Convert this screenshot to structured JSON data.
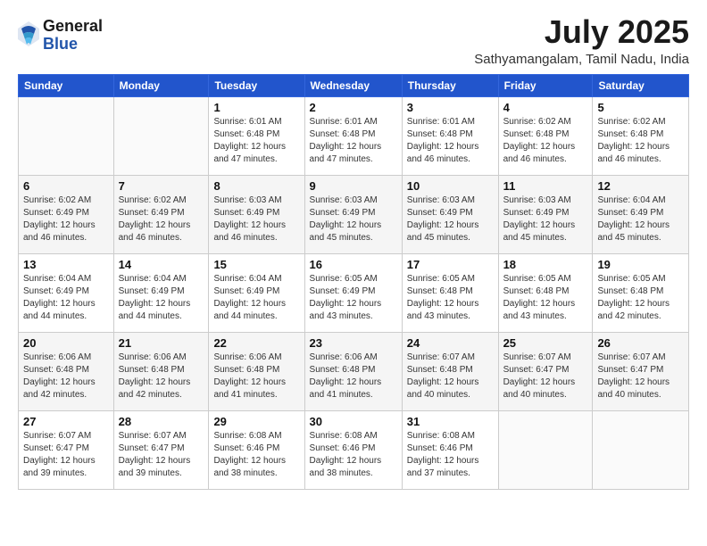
{
  "header": {
    "logo": {
      "general": "General",
      "blue": "Blue"
    },
    "title": "July 2025",
    "location": "Sathyamangalam, Tamil Nadu, India"
  },
  "weekdays": [
    "Sunday",
    "Monday",
    "Tuesday",
    "Wednesday",
    "Thursday",
    "Friday",
    "Saturday"
  ],
  "weeks": [
    [
      {
        "day": "",
        "sunrise": "",
        "sunset": "",
        "daylight": ""
      },
      {
        "day": "",
        "sunrise": "",
        "sunset": "",
        "daylight": ""
      },
      {
        "day": "1",
        "sunrise": "Sunrise: 6:01 AM",
        "sunset": "Sunset: 6:48 PM",
        "daylight": "Daylight: 12 hours and 47 minutes."
      },
      {
        "day": "2",
        "sunrise": "Sunrise: 6:01 AM",
        "sunset": "Sunset: 6:48 PM",
        "daylight": "Daylight: 12 hours and 47 minutes."
      },
      {
        "day": "3",
        "sunrise": "Sunrise: 6:01 AM",
        "sunset": "Sunset: 6:48 PM",
        "daylight": "Daylight: 12 hours and 46 minutes."
      },
      {
        "day": "4",
        "sunrise": "Sunrise: 6:02 AM",
        "sunset": "Sunset: 6:48 PM",
        "daylight": "Daylight: 12 hours and 46 minutes."
      },
      {
        "day": "5",
        "sunrise": "Sunrise: 6:02 AM",
        "sunset": "Sunset: 6:48 PM",
        "daylight": "Daylight: 12 hours and 46 minutes."
      }
    ],
    [
      {
        "day": "6",
        "sunrise": "Sunrise: 6:02 AM",
        "sunset": "Sunset: 6:49 PM",
        "daylight": "Daylight: 12 hours and 46 minutes."
      },
      {
        "day": "7",
        "sunrise": "Sunrise: 6:02 AM",
        "sunset": "Sunset: 6:49 PM",
        "daylight": "Daylight: 12 hours and 46 minutes."
      },
      {
        "day": "8",
        "sunrise": "Sunrise: 6:03 AM",
        "sunset": "Sunset: 6:49 PM",
        "daylight": "Daylight: 12 hours and 46 minutes."
      },
      {
        "day": "9",
        "sunrise": "Sunrise: 6:03 AM",
        "sunset": "Sunset: 6:49 PM",
        "daylight": "Daylight: 12 hours and 45 minutes."
      },
      {
        "day": "10",
        "sunrise": "Sunrise: 6:03 AM",
        "sunset": "Sunset: 6:49 PM",
        "daylight": "Daylight: 12 hours and 45 minutes."
      },
      {
        "day": "11",
        "sunrise": "Sunrise: 6:03 AM",
        "sunset": "Sunset: 6:49 PM",
        "daylight": "Daylight: 12 hours and 45 minutes."
      },
      {
        "day": "12",
        "sunrise": "Sunrise: 6:04 AM",
        "sunset": "Sunset: 6:49 PM",
        "daylight": "Daylight: 12 hours and 45 minutes."
      }
    ],
    [
      {
        "day": "13",
        "sunrise": "Sunrise: 6:04 AM",
        "sunset": "Sunset: 6:49 PM",
        "daylight": "Daylight: 12 hours and 44 minutes."
      },
      {
        "day": "14",
        "sunrise": "Sunrise: 6:04 AM",
        "sunset": "Sunset: 6:49 PM",
        "daylight": "Daylight: 12 hours and 44 minutes."
      },
      {
        "day": "15",
        "sunrise": "Sunrise: 6:04 AM",
        "sunset": "Sunset: 6:49 PM",
        "daylight": "Daylight: 12 hours and 44 minutes."
      },
      {
        "day": "16",
        "sunrise": "Sunrise: 6:05 AM",
        "sunset": "Sunset: 6:49 PM",
        "daylight": "Daylight: 12 hours and 43 minutes."
      },
      {
        "day": "17",
        "sunrise": "Sunrise: 6:05 AM",
        "sunset": "Sunset: 6:48 PM",
        "daylight": "Daylight: 12 hours and 43 minutes."
      },
      {
        "day": "18",
        "sunrise": "Sunrise: 6:05 AM",
        "sunset": "Sunset: 6:48 PM",
        "daylight": "Daylight: 12 hours and 43 minutes."
      },
      {
        "day": "19",
        "sunrise": "Sunrise: 6:05 AM",
        "sunset": "Sunset: 6:48 PM",
        "daylight": "Daylight: 12 hours and 42 minutes."
      }
    ],
    [
      {
        "day": "20",
        "sunrise": "Sunrise: 6:06 AM",
        "sunset": "Sunset: 6:48 PM",
        "daylight": "Daylight: 12 hours and 42 minutes."
      },
      {
        "day": "21",
        "sunrise": "Sunrise: 6:06 AM",
        "sunset": "Sunset: 6:48 PM",
        "daylight": "Daylight: 12 hours and 42 minutes."
      },
      {
        "day": "22",
        "sunrise": "Sunrise: 6:06 AM",
        "sunset": "Sunset: 6:48 PM",
        "daylight": "Daylight: 12 hours and 41 minutes."
      },
      {
        "day": "23",
        "sunrise": "Sunrise: 6:06 AM",
        "sunset": "Sunset: 6:48 PM",
        "daylight": "Daylight: 12 hours and 41 minutes."
      },
      {
        "day": "24",
        "sunrise": "Sunrise: 6:07 AM",
        "sunset": "Sunset: 6:48 PM",
        "daylight": "Daylight: 12 hours and 40 minutes."
      },
      {
        "day": "25",
        "sunrise": "Sunrise: 6:07 AM",
        "sunset": "Sunset: 6:47 PM",
        "daylight": "Daylight: 12 hours and 40 minutes."
      },
      {
        "day": "26",
        "sunrise": "Sunrise: 6:07 AM",
        "sunset": "Sunset: 6:47 PM",
        "daylight": "Daylight: 12 hours and 40 minutes."
      }
    ],
    [
      {
        "day": "27",
        "sunrise": "Sunrise: 6:07 AM",
        "sunset": "Sunset: 6:47 PM",
        "daylight": "Daylight: 12 hours and 39 minutes."
      },
      {
        "day": "28",
        "sunrise": "Sunrise: 6:07 AM",
        "sunset": "Sunset: 6:47 PM",
        "daylight": "Daylight: 12 hours and 39 minutes."
      },
      {
        "day": "29",
        "sunrise": "Sunrise: 6:08 AM",
        "sunset": "Sunset: 6:46 PM",
        "daylight": "Daylight: 12 hours and 38 minutes."
      },
      {
        "day": "30",
        "sunrise": "Sunrise: 6:08 AM",
        "sunset": "Sunset: 6:46 PM",
        "daylight": "Daylight: 12 hours and 38 minutes."
      },
      {
        "day": "31",
        "sunrise": "Sunrise: 6:08 AM",
        "sunset": "Sunset: 6:46 PM",
        "daylight": "Daylight: 12 hours and 37 minutes."
      },
      {
        "day": "",
        "sunrise": "",
        "sunset": "",
        "daylight": ""
      },
      {
        "day": "",
        "sunrise": "",
        "sunset": "",
        "daylight": ""
      }
    ]
  ]
}
